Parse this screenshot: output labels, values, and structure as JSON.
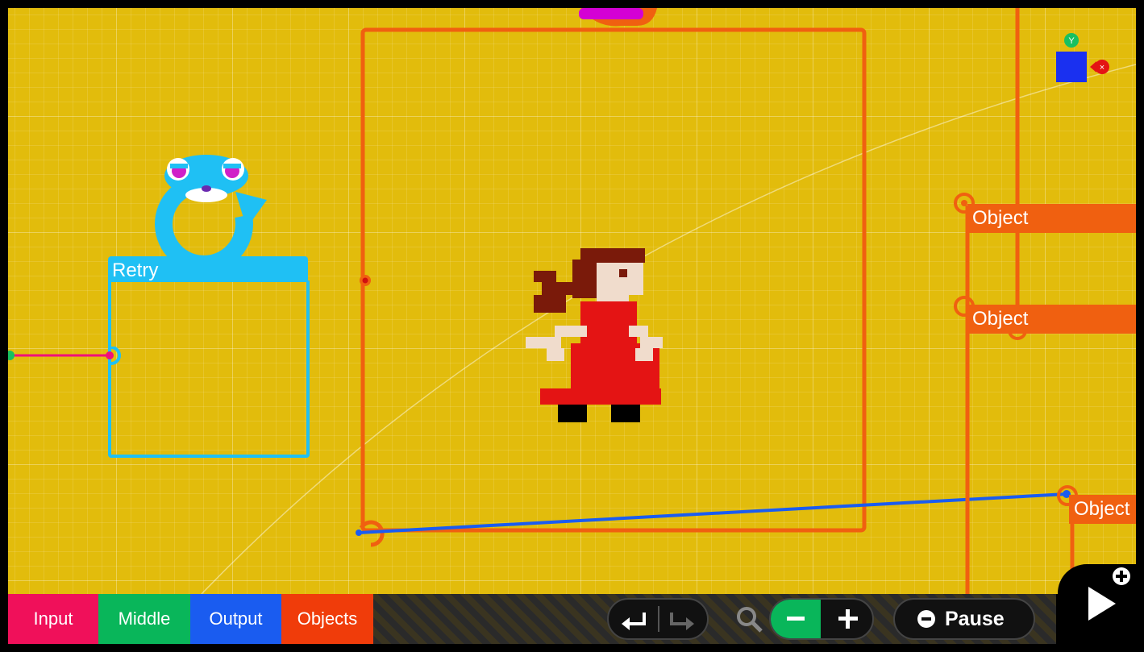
{
  "nodes": {
    "retry_label": "Retry",
    "object_labels": [
      "Object",
      "Object",
      "Object"
    ]
  },
  "toolbar": {
    "tabs": [
      {
        "label": "Input",
        "color": "#f0105a"
      },
      {
        "label": "Middle",
        "color": "#09b65a"
      },
      {
        "label": "Output",
        "color": "#1a5cf0"
      },
      {
        "label": "Objects",
        "color": "#f03c0a"
      }
    ],
    "pause_label": "Pause"
  },
  "colors": {
    "canvas": "#e2bc0c",
    "frame": "#f06010",
    "retry": "#1fc0f4",
    "wire_blue": "#1a5cf0",
    "wire_pink": "#f0107a"
  },
  "icons": [
    "retry-mascot-icon",
    "character-sprite",
    "undo-icon",
    "redo-icon",
    "zoom-icon",
    "zoom-out-icon",
    "zoom-in-icon",
    "minus-circle-icon",
    "play-icon",
    "plus-icon",
    "y-button-icon",
    "x-button-icon"
  ]
}
